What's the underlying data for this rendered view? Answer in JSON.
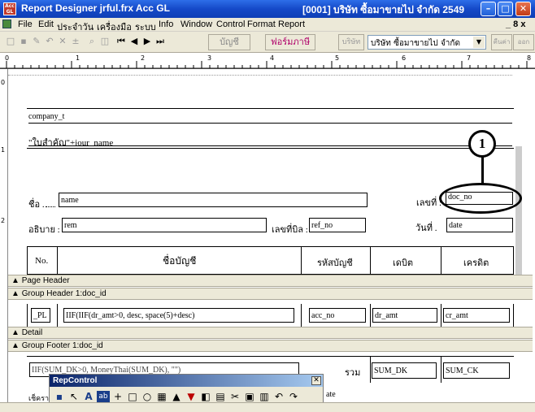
{
  "window": {
    "title": "Report Designer   jrful.frx  Acc GL",
    "title_right": "[0001]  บริษัท ซื้อมาขายไป จำกัด  2549",
    "app_icon": "report-app-icon",
    "minimize": "–",
    "maximize": "□",
    "close": "✕"
  },
  "menubar": {
    "items": [
      "File",
      "Edit",
      "ประจำวัน",
      "เครื่องมือ",
      "ระบบ",
      "Info",
      "Window",
      "Control",
      "Format",
      "Report"
    ],
    "right": "_ 8 x"
  },
  "toolbar": {
    "btn_account": "บัญชี",
    "btn_form": "ฟอร์มภาษี",
    "btn_company": "บริษัท",
    "company_select": "บริษัท ซื้อมาขายไป จำกัด",
    "btn_right1": "คืนค่า",
    "btn_right2": "ออก"
  },
  "ruler": {
    "marks": [
      "0",
      "1",
      "2",
      "3",
      "4",
      "5",
      "6",
      "7",
      "8"
    ]
  },
  "report": {
    "company_field": "company_t",
    "branch_field": "\"ใบสำคัญ\"+jour_name",
    "label_name": "ชื่อ .",
    "field_name": "name",
    "label_no": "เลขที่ :",
    "field_doc_no": "doc_no",
    "label_desc": "อธิบาย :",
    "field_rem": "rem",
    "label_bill": "เลขที่บิล :",
    "field_ref": "ref_no",
    "label_date": "วันที่ .",
    "field_date": "date",
    "callout": "1",
    "columns": [
      "No.",
      "ชื่อบัญชี",
      "รหัสบัญชี",
      "เดบิต",
      "เครดิต"
    ]
  },
  "bands": {
    "page_header": "Page Header",
    "group_header": "Group Header 1:doc_id",
    "detail": "Detail",
    "group_footer": "Group Footer 1:doc_id"
  },
  "detail": {
    "pl": "_PL",
    "desc_expr": "IIF(IIF(dr_amt>0, desc, space(5)+desc)",
    "acc_no": "acc_no",
    "dr_amt": "dr_amt",
    "cr_amt": "cr_amt"
  },
  "footer": {
    "expr": "IIF(SUM_DK>0, MoneyThai(SUM_DK), \"\")",
    "label_total": "รวม",
    "sum_dk": "SUM_DK",
    "sum_ck": "SUM_CK",
    "label_checker": "เช็คราย",
    "date_field": "ate"
  },
  "rep_control": {
    "title": "RepControl",
    "close": "✕",
    "tools": [
      "▪",
      "↖",
      "A",
      "ab",
      "+",
      "□",
      "○",
      "▦",
      "▲",
      "▼",
      "◧",
      "▤",
      "✂",
      "▣",
      "▥",
      "↶",
      "↷"
    ]
  }
}
